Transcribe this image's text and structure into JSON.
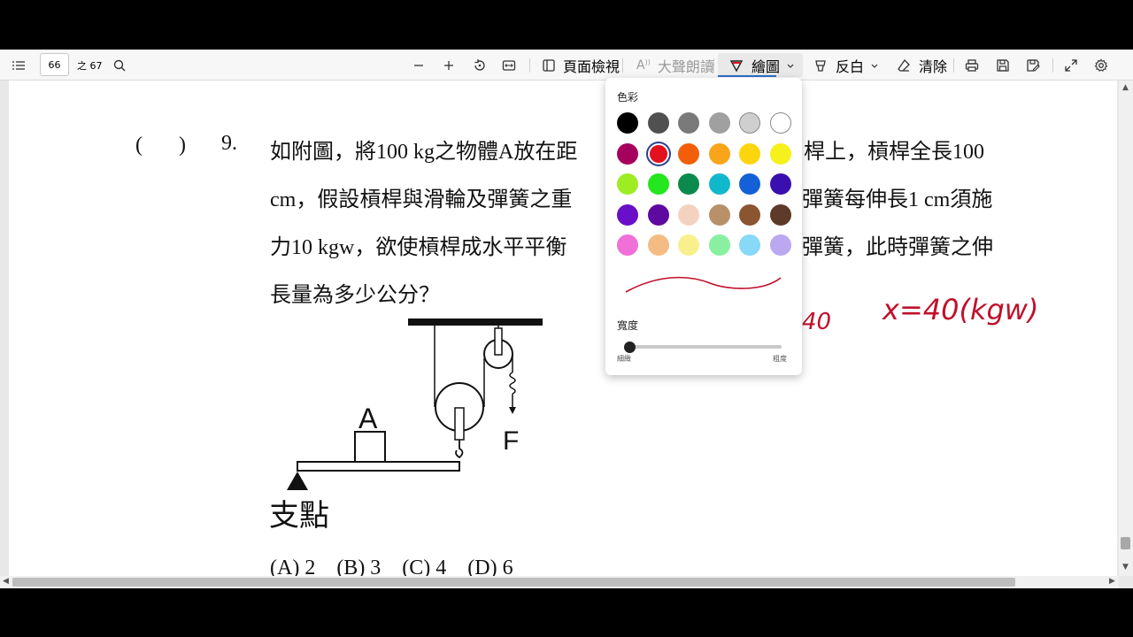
{
  "toolbar": {
    "page_current": "66",
    "page_total": "之 67",
    "view_label": "頁面檢視",
    "read_aloud_label": "大聲朗讀",
    "draw_label": "繪圖",
    "highlight_label": "反白",
    "erase_label": "清除"
  },
  "question": {
    "bracket_open": "(",
    "bracket_close": ")",
    "number": "9.",
    "line1": "如附圖，將100 kg之物體A放在距",
    "line1b": "桿上，槓桿全長100",
    "line2": "cm，假設槓桿與滑輪及彈簧之重",
    "line2b": "彈簧每伸長1 cm須施",
    "line3": "力10 kgw，欲使槓桿成水平平衡",
    "line3b": "彈簧，此時彈簧之伸",
    "line4": "長量為多少公分？",
    "options": "(A) 2　(B) 3　(C) 4　(D) 6"
  },
  "figure": {
    "block_label": "A",
    "force_label": "F",
    "fulcrum_label": "支點"
  },
  "handwriting": {
    "partial": "40",
    "equation": "x=40(kgw)"
  },
  "draw_panel": {
    "color_title": "色彩",
    "width_title": "寬度",
    "width_min": "細緻",
    "width_max": "粗度",
    "selected_color": "#e3101e",
    "colors": [
      "#000000",
      "#505050",
      "#7a7a7a",
      "#a0a0a0",
      "#cfcfcf",
      "#ffffff",
      "#a6005e",
      "#e3101e",
      "#f25e0a",
      "#f8a51b",
      "#fcd50f",
      "#f6f01c",
      "#9ded22",
      "#26e61f",
      "#0a8a4c",
      "#10b8cc",
      "#1460d6",
      "#3a0fb0",
      "#6a0fc8",
      "#5e0aa0",
      "#f4d2c0",
      "#b8906a",
      "#8a5530",
      "#5e3a28",
      "#f070d8",
      "#f4bc84",
      "#f8f08c",
      "#88f0a0",
      "#88d8f8",
      "#baa8f0"
    ]
  }
}
